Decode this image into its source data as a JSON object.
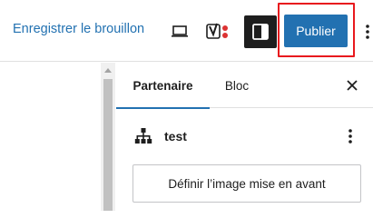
{
  "toolbar": {
    "save_draft_label": "Enregistrer le brouillon",
    "publish_label": "Publier",
    "preview_icon": "laptop-icon",
    "yoast_icon": "yoast-seo-icon",
    "settings_icon": "sidebar-toggle-icon",
    "more_icon": "vertical-ellipsis-icon"
  },
  "sidebar": {
    "tabs": [
      {
        "label": "Partenaire",
        "active": true
      },
      {
        "label": "Bloc",
        "active": false
      }
    ],
    "close_icon": "close-icon",
    "block": {
      "icon": "hierarchy-icon",
      "title": "test",
      "more_icon": "vertical-ellipsis-icon",
      "featured_image_button": "Définir l’image mise en avant"
    }
  },
  "colors": {
    "accent": "#2271b1",
    "highlight": "#e8191e",
    "yoast_dot": "#dc3232",
    "dark_button": "#1e1e1e"
  }
}
